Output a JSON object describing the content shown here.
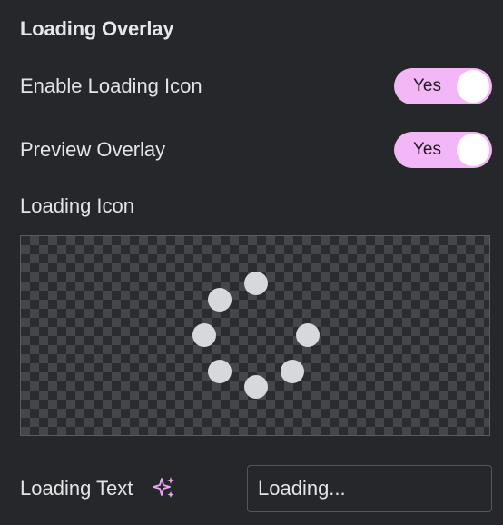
{
  "section": {
    "title": "Loading Overlay"
  },
  "enable_loading_icon": {
    "label": "Enable Loading Icon",
    "toggle_text": "Yes",
    "checked": true
  },
  "preview_overlay": {
    "label": "Preview Overlay",
    "toggle_text": "Yes",
    "checked": true
  },
  "loading_icon": {
    "label": "Loading Icon",
    "icon": "spinner-dots-icon"
  },
  "loading_text": {
    "label": "Loading Text",
    "value": "Loading...",
    "ai_icon": "sparkle-icon"
  },
  "colors": {
    "background": "#26272b",
    "toggle_on": "#f3b7f7",
    "sparkle": "#e9a7f2",
    "spinner_dot": "#d7d8dc"
  }
}
